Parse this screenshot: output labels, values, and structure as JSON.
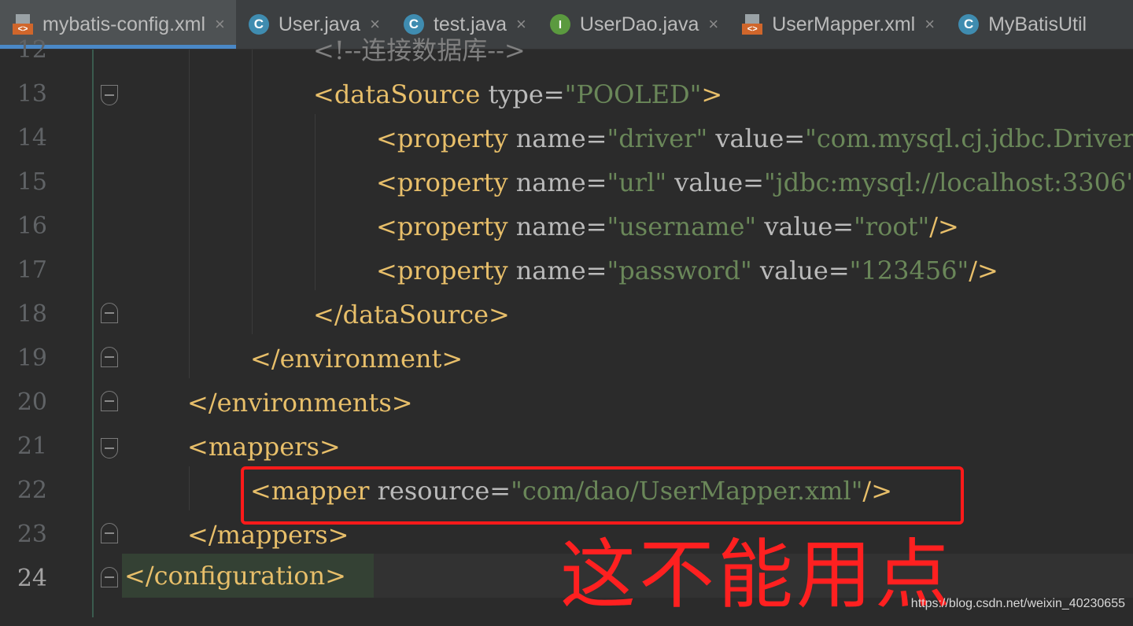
{
  "tabs": [
    {
      "label": "mybatis-config.xml",
      "icon": "xml-file-icon",
      "active": true
    },
    {
      "label": "User.java",
      "icon": "class-icon"
    },
    {
      "label": "test.java",
      "icon": "class-icon"
    },
    {
      "label": "UserDao.java",
      "icon": "interface-icon"
    },
    {
      "label": "UserMapper.xml",
      "icon": "xml-file-icon"
    },
    {
      "label": "MyBatisUtil",
      "icon": "class-icon"
    }
  ],
  "close_glyph": "×",
  "line_numbers": [
    "12",
    "13",
    "14",
    "15",
    "16",
    "17",
    "18",
    "19",
    "20",
    "21",
    "22",
    "23",
    "24"
  ],
  "code": {
    "l12": {
      "comment": "<!--连接数据库-->"
    },
    "l13": {
      "open": "<dataSource",
      "attr": " type=",
      "val": "\"POOLED\"",
      "close": ">"
    },
    "l14": {
      "open": "<property",
      "a1": " name=",
      "v1": "\"driver\"",
      "a2": " value=",
      "v2": "\"com.mysql.cj.jdbc.Driver\""
    },
    "l15": {
      "open": "<property",
      "a1": " name=",
      "v1": "\"url\"",
      "a2": " value=",
      "v2": "\"jdbc:mysql://localhost:3306\""
    },
    "l16": {
      "open": "<property",
      "a1": " name=",
      "v1": "\"username\"",
      "a2": " value=",
      "v2": "\"root\"",
      "close": "/>"
    },
    "l17": {
      "open": "<property",
      "a1": " name=",
      "v1": "\"password\"",
      "a2": " value=",
      "v2": "\"123456\"",
      "close": "/>"
    },
    "l18": {
      "tag": "</dataSource>"
    },
    "l19": {
      "tag": "</environment>"
    },
    "l20": {
      "tag": "</environments>"
    },
    "l21": {
      "tag": "<mappers>"
    },
    "l22": {
      "open": "<mapper",
      "attr": " resource=",
      "val": "\"com/dao/UserMapper.xml\"",
      "close": "/>"
    },
    "l23": {
      "tag": "</mappers>"
    },
    "l24": {
      "tag": "</configuration>"
    }
  },
  "annotation": "这不能用点",
  "watermark": "https://blog.csdn.net/weixin_40230655",
  "colors": {
    "tag": "#e8bf6a",
    "attr": "#bababa",
    "value": "#6a8759",
    "annotation": "#ff2020",
    "active_tab_underline": "#4a88c7"
  }
}
